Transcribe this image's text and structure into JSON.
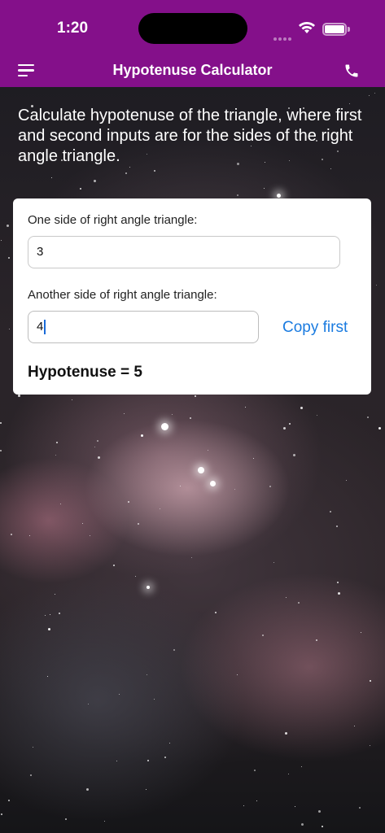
{
  "status_bar": {
    "time": "1:20"
  },
  "header": {
    "title": "Hypotenuse Calculator"
  },
  "intro": "Calculate hypotenuse of the triangle, where first and second inputs are for the sides of the right angle triangle.",
  "form": {
    "side1_label": "One side of right angle triangle:",
    "side1_value": "3",
    "side2_label": "Another side of right angle triangle:",
    "side2_value": "4",
    "copy_label": "Copy first",
    "result": "Hypotenuse = 5"
  },
  "colors": {
    "header_bg": "#84108a",
    "link": "#1a7be0"
  },
  "icons": {
    "menu": "hamburger-menu-icon",
    "call": "phone-icon",
    "wifi": "wifi-icon",
    "battery": "battery-icon"
  }
}
